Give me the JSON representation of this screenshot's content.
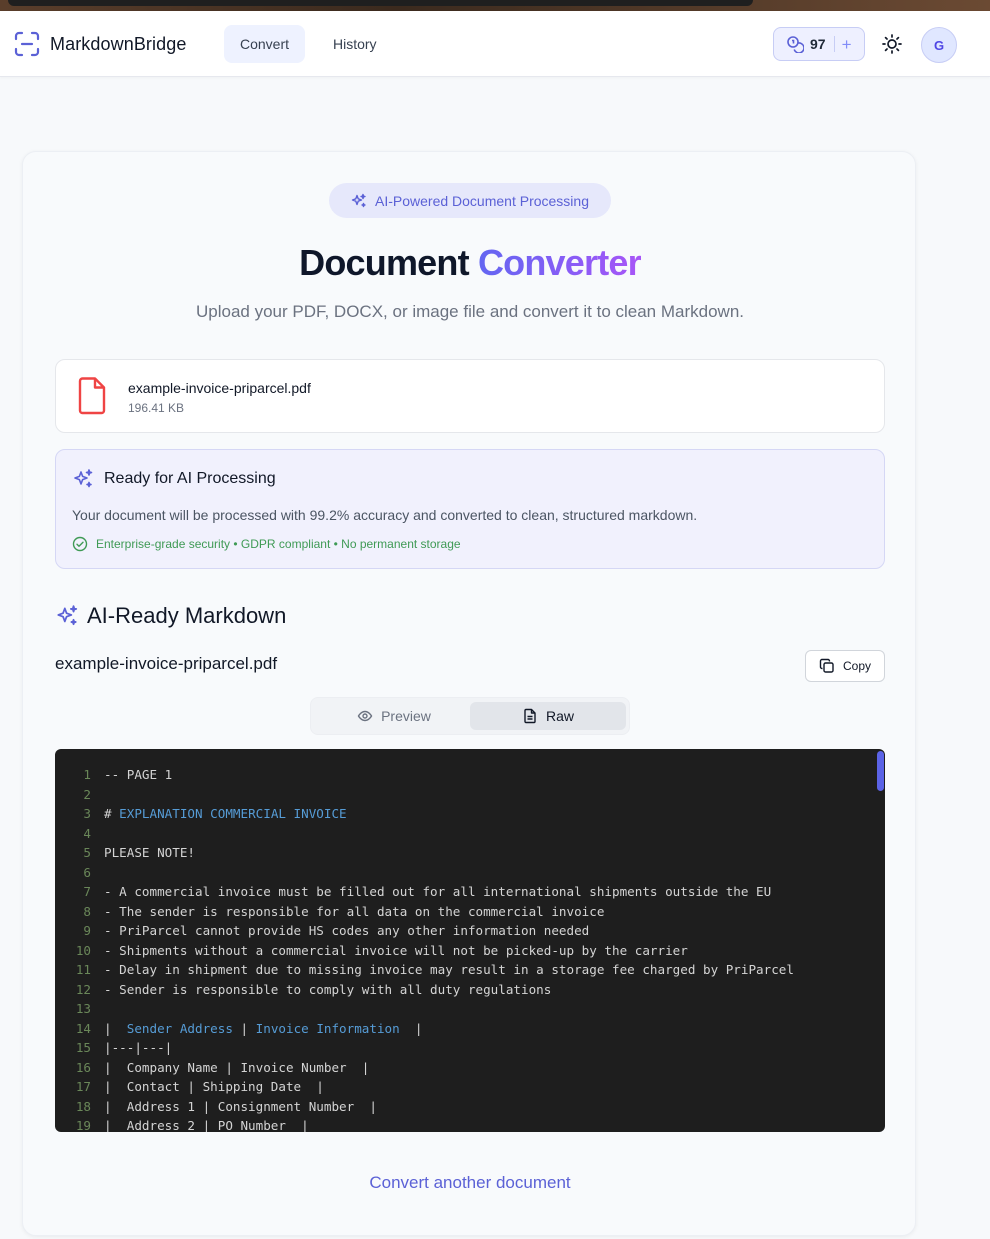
{
  "app": {
    "brand": "MarkdownBridge"
  },
  "nav": {
    "tabs": [
      "Convert",
      "History"
    ]
  },
  "credits": {
    "count": "97",
    "plus": "+"
  },
  "user": {
    "initial": "G"
  },
  "hero": {
    "badge": "AI-Powered Document Processing",
    "title_main": "Document ",
    "title_accent": "Converter",
    "subtitle": "Upload your PDF, DOCX, or image file and convert it to clean Markdown."
  },
  "file": {
    "name": "example-invoice-priparcel.pdf",
    "size": "196.41 KB"
  },
  "ai_card": {
    "title": "Ready for AI Processing",
    "description": "Your document will be processed with 99.2% accuracy and converted to clean, structured markdown.",
    "security": "Enterprise-grade security • GDPR compliant • No permanent storage"
  },
  "result": {
    "section_title": "AI-Ready Markdown",
    "doc_name": "example-invoice-priparcel.pdf",
    "copy_label": "Copy",
    "view_modes": [
      "Preview",
      "Raw"
    ],
    "active_view": "Raw"
  },
  "code_lines": [
    {
      "n": "1",
      "pre": "-- PAGE 1",
      "kw": "",
      "post": ""
    },
    {
      "n": "2",
      "pre": "",
      "kw": "",
      "post": ""
    },
    {
      "n": "3",
      "pre": "# ",
      "kw": "EXPLANATION COMMERCIAL INVOICE",
      "post": ""
    },
    {
      "n": "4",
      "pre": "",
      "kw": "",
      "post": ""
    },
    {
      "n": "5",
      "pre": "PLEASE NOTE!",
      "kw": "",
      "post": ""
    },
    {
      "n": "6",
      "pre": "",
      "kw": "",
      "post": ""
    },
    {
      "n": "7",
      "pre": "- A commercial invoice must be filled out for all international shipments outside the EU",
      "kw": "",
      "post": ""
    },
    {
      "n": "8",
      "pre": "- The sender is responsible for all data on the commercial invoice",
      "kw": "",
      "post": ""
    },
    {
      "n": "9",
      "pre": "- PriParcel cannot provide HS codes any other information needed",
      "kw": "",
      "post": ""
    },
    {
      "n": "10",
      "pre": "- Shipments without a commercial invoice will not be picked-up by the carrier",
      "kw": "",
      "post": ""
    },
    {
      "n": "11",
      "pre": "- Delay in shipment due to missing invoice may result in a storage fee charged by PriParcel",
      "kw": "",
      "post": ""
    },
    {
      "n": "12",
      "pre": "- Sender is responsible to comply with all duty regulations",
      "kw": "",
      "post": ""
    },
    {
      "n": "13",
      "pre": "",
      "kw": "",
      "post": ""
    },
    {
      "n": "14",
      "pre": "|  ",
      "kw": "Sender Address",
      "post": " | ",
      "kw2": "Invoice Information",
      "post2": "  |"
    },
    {
      "n": "15",
      "pre": "|---|---|",
      "kw": "",
      "post": ""
    },
    {
      "n": "16",
      "pre": "|  Company Name | Invoice Number  |",
      "kw": "",
      "post": ""
    },
    {
      "n": "17",
      "pre": "|  Contact | Shipping Date  |",
      "kw": "",
      "post": ""
    },
    {
      "n": "18",
      "pre": "|  Address 1 | Consignment Number  |",
      "kw": "",
      "post": ""
    },
    {
      "n": "19",
      "pre": "|  Address 2 | PO Number  |",
      "kw": "",
      "post": ""
    }
  ],
  "footer": {
    "convert_again": "Convert another document"
  },
  "colors": {
    "accent": "#6366f1",
    "code_bg": "#1e1e1e",
    "success": "#3f9a55",
    "file_icon": "#ef4444"
  }
}
